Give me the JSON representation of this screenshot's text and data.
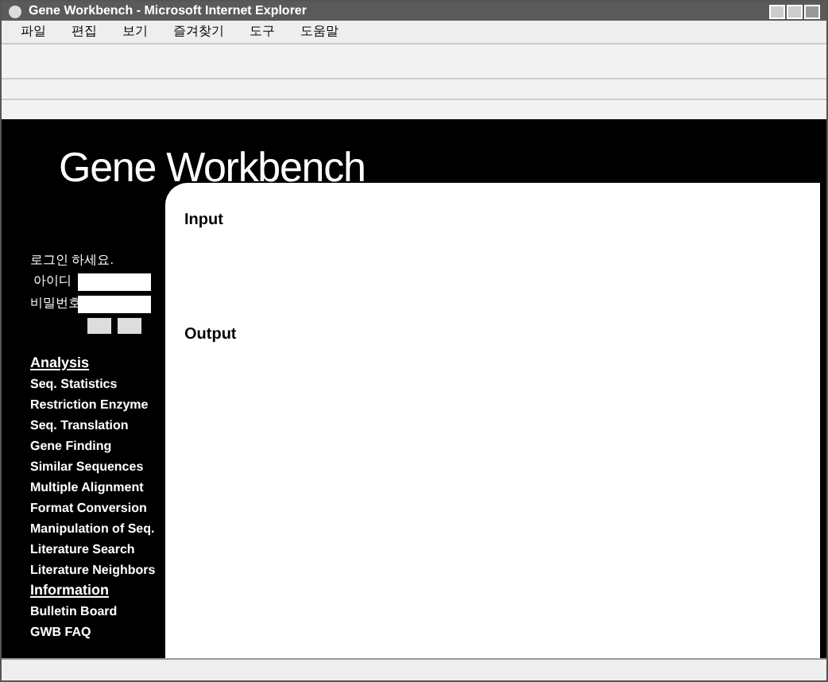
{
  "window": {
    "title": "Gene Workbench - Microsoft Internet Explorer"
  },
  "menu": [
    "파일",
    "편집",
    "보기",
    "즐겨찾기",
    "도구",
    "도움말"
  ],
  "header": {
    "title": "Gene Workbench"
  },
  "login": {
    "prompt": "로그인 하세요.",
    "id_label": "아이디",
    "password_label": "비밀번호"
  },
  "nav": [
    {
      "label": "Analysis",
      "kind": "heading"
    },
    {
      "label": "Seq. Statistics",
      "kind": "link"
    },
    {
      "label": "Restriction Enzyme",
      "kind": "link"
    },
    {
      "label": "Seq. Translation",
      "kind": "link"
    },
    {
      "label": "Gene Finding",
      "kind": "link"
    },
    {
      "label": "Similar Sequences",
      "kind": "link"
    },
    {
      "label": "Multiple Alignment",
      "kind": "link"
    },
    {
      "label": "Format Conversion",
      "kind": "link"
    },
    {
      "label": "Manipulation of Seq.",
      "kind": "link"
    },
    {
      "label": "Literature Search",
      "kind": "link"
    },
    {
      "label": "Literature Neighbors",
      "kind": "link"
    },
    {
      "label": "Information",
      "kind": "heading"
    },
    {
      "label": "Bulletin Board",
      "kind": "link"
    },
    {
      "label": "GWB FAQ",
      "kind": "link"
    }
  ],
  "sections": [
    {
      "title": "Input"
    },
    {
      "title": "Output"
    }
  ]
}
